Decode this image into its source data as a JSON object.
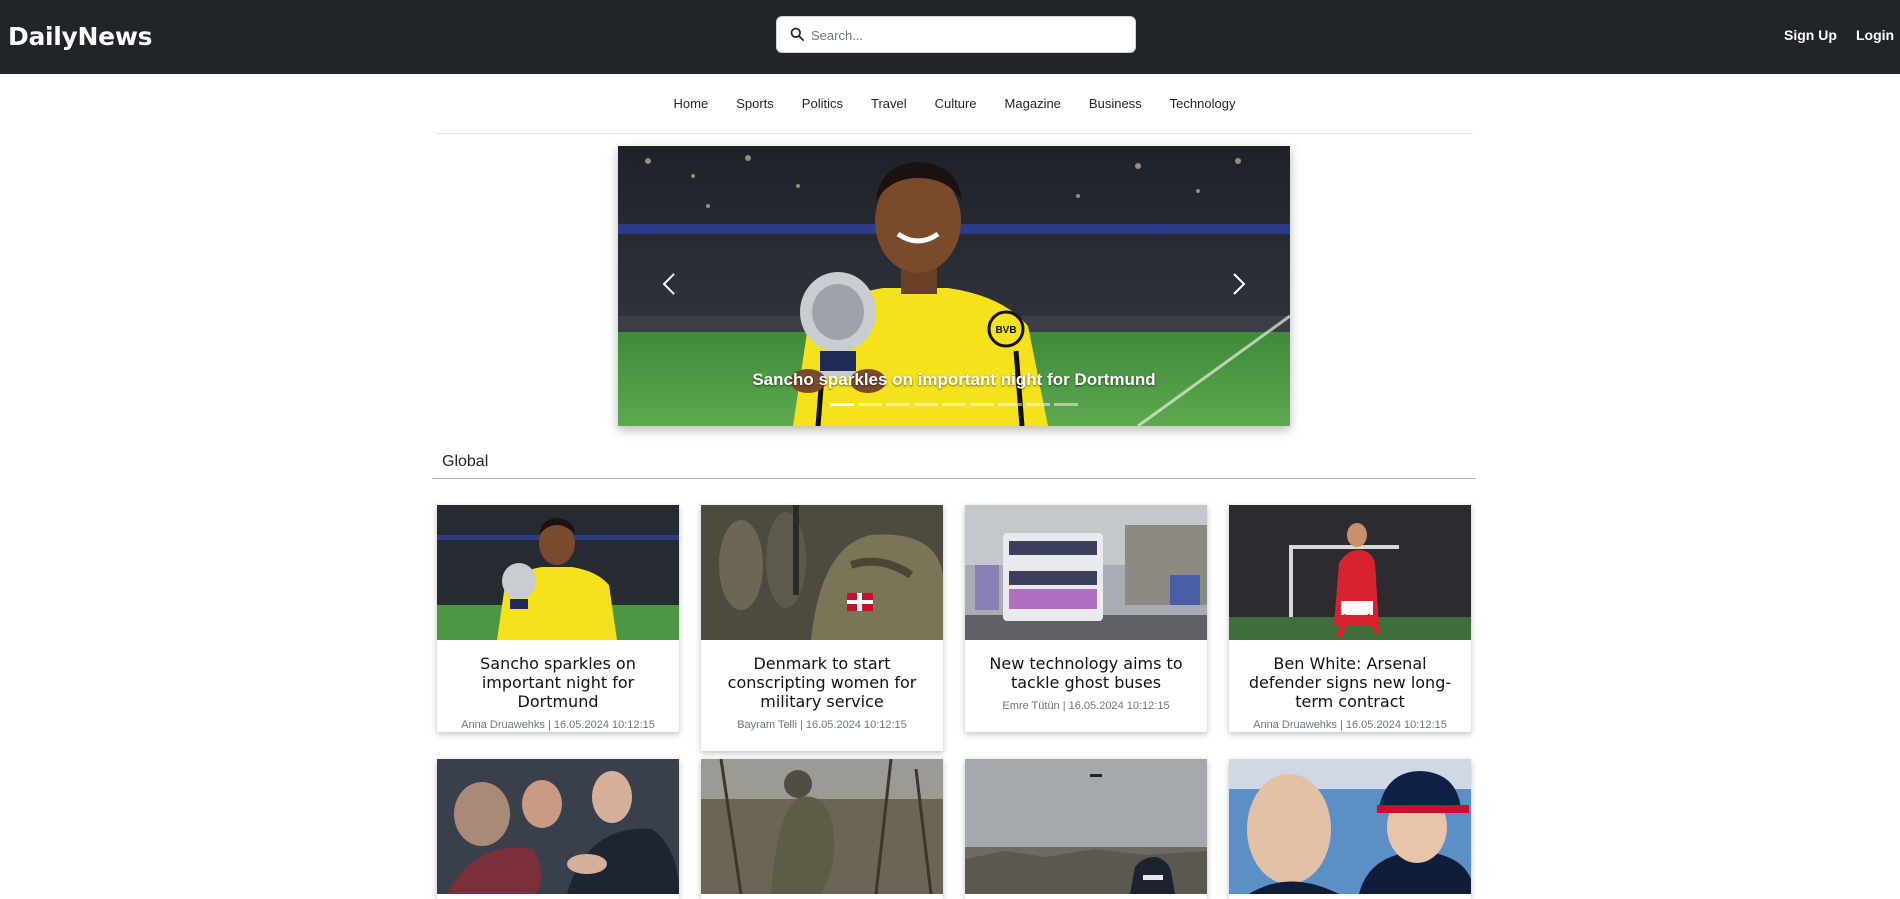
{
  "header": {
    "brand": "DailyNews",
    "search_placeholder": "Search...",
    "signup": "Sign Up",
    "login": "Login"
  },
  "nav": {
    "items": [
      "Home",
      "Sports",
      "Politics",
      "Travel",
      "Culture",
      "Magazine",
      "Business",
      "Technology"
    ]
  },
  "carousel": {
    "caption": "Sancho sparkles on important night for Dortmund",
    "slide_count": 9,
    "active_index": 0,
    "prev_icon": "chevron-left-icon",
    "next_icon": "chevron-right-icon"
  },
  "section": {
    "title": "Global"
  },
  "articles": [
    {
      "title": "Sancho sparkles on important night for Dortmund",
      "meta": "Anna Druawehks | 16.05.2024 10:12:15"
    },
    {
      "title": "Denmark to start conscripting women for military service",
      "meta": "Bayram Telli | 16.05.2024 10:12:15"
    },
    {
      "title": "New technology aims to tackle ghost buses",
      "meta": "Emre Tütün | 16.05.2024 10:12:15"
    },
    {
      "title": "Ben White: Arsenal defender signs new long-term contract",
      "meta": "Anna Druawehks | 16.05.2024 10:12:15"
    }
  ],
  "colors": {
    "topbar": "#212529",
    "accent_yellow": "#f5e000"
  }
}
